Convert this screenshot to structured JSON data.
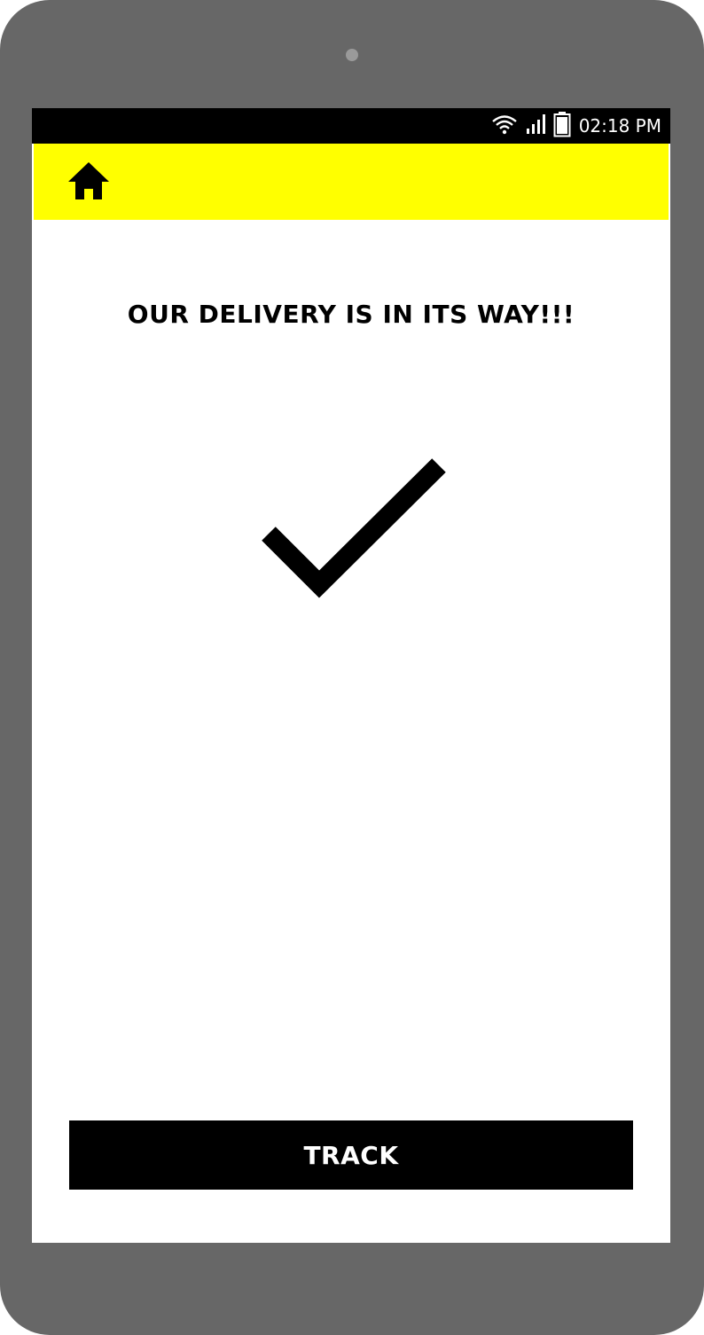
{
  "status_bar": {
    "time": "02:18 PM",
    "icons": [
      "wifi-icon",
      "signal-icon",
      "battery-icon"
    ]
  },
  "app_bar": {
    "background_color": "#ffff00",
    "home_icon": "home-icon"
  },
  "main": {
    "message": "OUR DELIVERY IS IN ITS WAY!!!",
    "status_icon": "checkmark-icon"
  },
  "actions": {
    "track_label": "TRACK"
  },
  "colors": {
    "device_frame": "#676767",
    "accent": "#ffff00",
    "button": "#000000"
  }
}
